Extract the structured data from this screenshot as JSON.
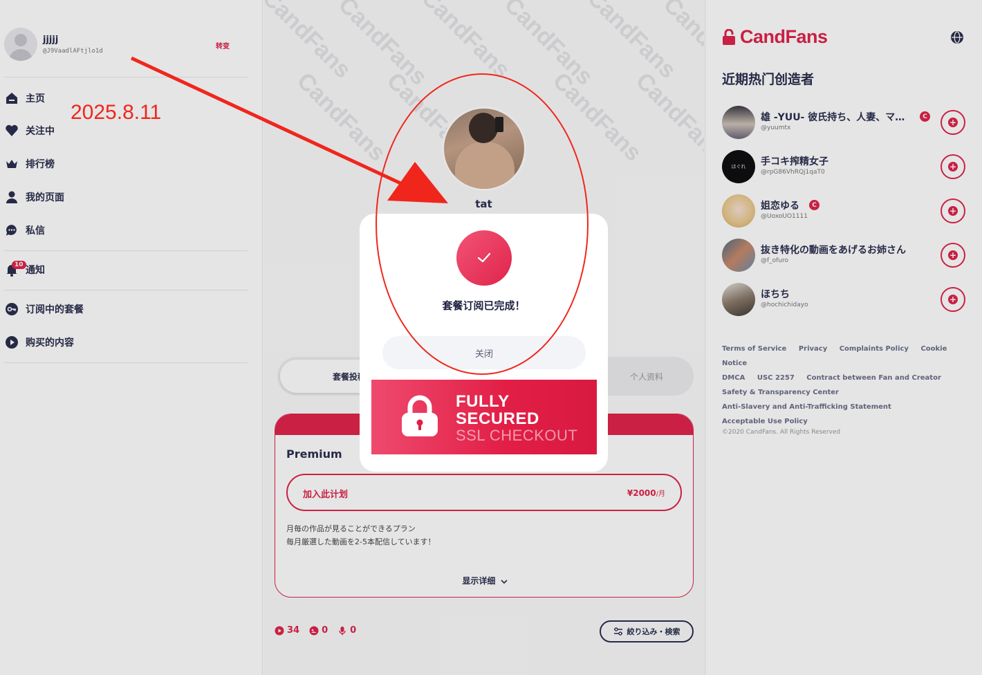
{
  "user": {
    "name": "jjjjj",
    "handle": "@J9VaadlAFtjlo1d",
    "switch_label": "转变"
  },
  "nav": {
    "home": "主页",
    "following": "关注中",
    "ranking": "排行榜",
    "my_page": "我的页面",
    "messages": "私信",
    "notifications": "通知",
    "notifications_badge": "10",
    "subscriptions": "订阅中的套餐",
    "purchased": "购买的内容"
  },
  "annotation": {
    "date": "2025.8.11",
    "color": "#f0261c"
  },
  "cover": {
    "watermark": "CandFans"
  },
  "profile": {
    "name": "tat"
  },
  "tabs": {
    "plan_posts": "套餐投稿",
    "profile": "个人资料"
  },
  "plan": {
    "name": "Premium",
    "join_label": "加入此计划",
    "price": "¥2000",
    "price_unit": "/月",
    "desc_line1": "月毎の作品が見ることができるプラン",
    "desc_line2": "毎月厳選した動画を2-5本配信しています！",
    "details_label": "显示详细"
  },
  "stats": {
    "videos": "34",
    "images": "0",
    "audio": "0"
  },
  "filter_label": "絞り込み・検索",
  "modal": {
    "message": "套餐订阅已完成！",
    "close_label": "关闭",
    "ssl_line1": "FULLY",
    "ssl_line2": "SECURED",
    "ssl_line3": "SSL CHECKOUT"
  },
  "brand": {
    "name": "CandFans",
    "accent": "#e0244b"
  },
  "right": {
    "section_title": "近期热门创造者"
  },
  "creators": [
    {
      "name": "雄 -YUU- 彼氏持ち、人妻、マ…",
      "handle": "@yuumtx",
      "verified": true
    },
    {
      "name": "手コキ搾精女子",
      "handle": "@rpG86VhRQj1qaT0",
      "verified": false
    },
    {
      "name": "姐恋ゆる",
      "handle": "@UoxoUO1111",
      "verified": true
    },
    {
      "name": "抜き特化の動画をあげるお姉さん",
      "handle": "@f_ofuro",
      "verified": false
    },
    {
      "name": "ほちち",
      "handle": "@hochichidayo",
      "verified": false
    }
  ],
  "creator_avatar_text": "ほぐれ",
  "footer": {
    "terms": "Terms of Service",
    "privacy": "Privacy",
    "complaints": "Complaints Policy",
    "cookie": "Cookie Notice",
    "dmca": "DMCA",
    "usc": "USC 2257",
    "contract": "Contract between Fan and Creator",
    "safety": "Safety & Transparency Center",
    "anti_slavery": "Anti-Slavery and Anti-Trafficking Statement",
    "aup": "Acceptable Use Policy",
    "copyright": "©2020 CandFans. All Rights Reserved"
  }
}
